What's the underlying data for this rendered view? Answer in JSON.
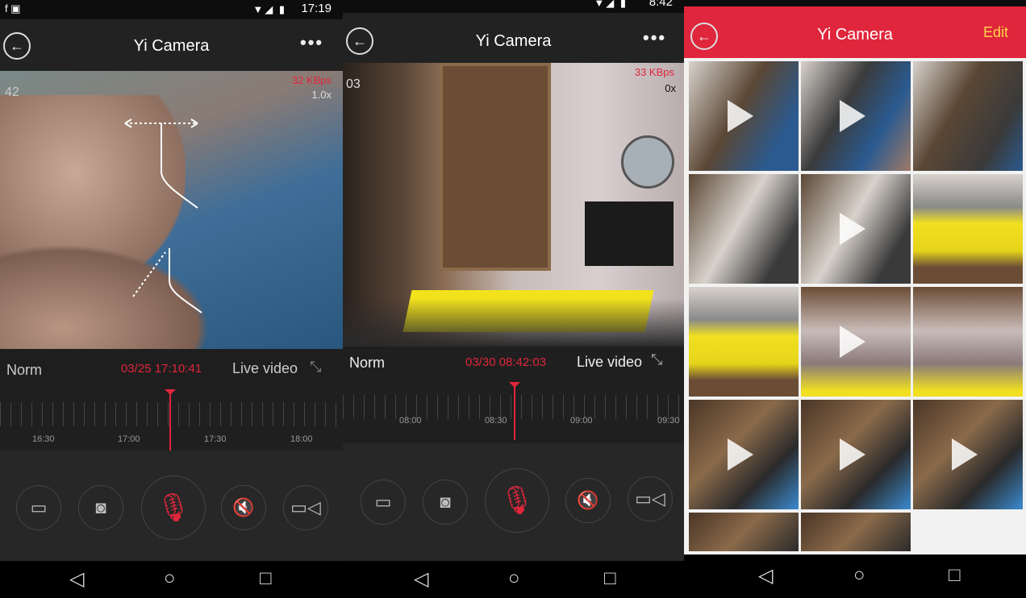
{
  "status_bar_1": {
    "time": "17:19"
  },
  "status_bar_2": {
    "time": "8:42"
  },
  "app": {
    "title": "Yi Camera"
  },
  "panel1": {
    "speed": "32 KBps",
    "zoom": "1.0x",
    "clip_label": "42",
    "quality": "Norm",
    "timestamp": "03/25 17:10:41",
    "live_label": "Live video",
    "ticks": [
      "16:30",
      "17:00",
      "17:30",
      "18:00"
    ]
  },
  "panel2": {
    "speed": "33 KBps",
    "zoom": "0x",
    "clip_label": "03",
    "quality": "Norm",
    "timestamp": "03/30 08:42:03",
    "live_label": "Live video",
    "ticks": [
      "08:00",
      "08:30",
      "09:00",
      "09:30"
    ]
  },
  "panel3": {
    "edit_label": "Edit"
  },
  "icons": {
    "back": "←",
    "more": "•••",
    "folder": "▭",
    "camera": "◙",
    "mic": "🎙",
    "mute": "🔇",
    "record": "▭◁",
    "fullscreen": "⤡",
    "nav_back": "◁",
    "nav_home": "○",
    "nav_recent": "□"
  },
  "colors": {
    "accent": "#e0263c",
    "edit": "#ffd54a"
  }
}
